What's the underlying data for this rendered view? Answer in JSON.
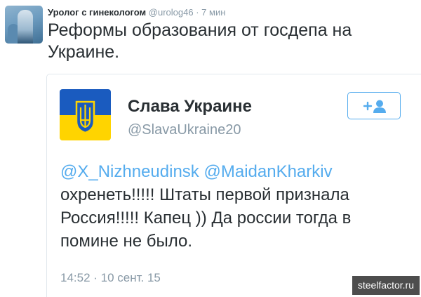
{
  "outer_tweet": {
    "author_name": "Уролог с гинекологом",
    "author_handle": "@urolog46",
    "separator": "·",
    "time_ago": "7 мин",
    "text": "Реформы образования от госдепа на Украине."
  },
  "quoted_tweet": {
    "author_name": "Слава Украине",
    "author_handle": "@SlavaUkraine20",
    "mentions": [
      "@X_Nizhneudinsk",
      "@MaidanKharkiv"
    ],
    "text": "охренеть!!!!! Штаты первой признала Россия!!!!! Капец )) Да россии тогда в помине не было.",
    "timestamp": "14:52 · 10 сент. 15",
    "follow_icon": "add-user-icon"
  },
  "watermark": {
    "text": "steelfactor.ru"
  },
  "colors": {
    "link_blue": "#55acee",
    "text_dark": "#292f33",
    "text_gray": "#8899a6",
    "flag_blue": "#1a5bbf",
    "flag_yellow": "#ffd400",
    "watermark_bg": "#4d4d4d"
  }
}
